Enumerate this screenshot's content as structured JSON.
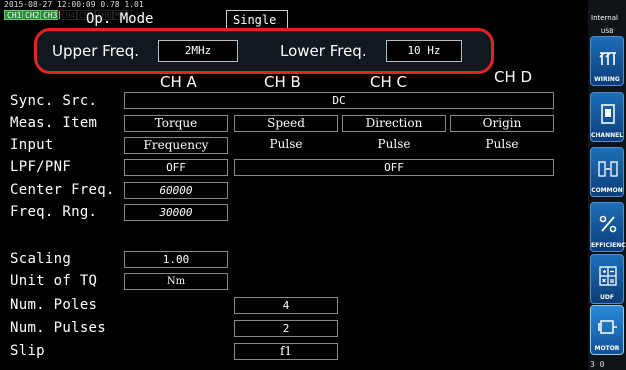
{
  "status": {
    "timestamp": "2015-08-27 12:00:09 0.78 1.01",
    "channels": [
      {
        "label": "CH1",
        "active": true
      },
      {
        "label": "CH2",
        "active": true
      },
      {
        "label": "CH3",
        "active": true
      },
      {
        "label": "CH4",
        "active": false
      },
      {
        "label": "CH5",
        "active": false
      },
      {
        "label": "CH6",
        "active": false
      },
      {
        "label": "MOT",
        "active": false
      }
    ]
  },
  "op_mode": {
    "label": "Op. Mode",
    "value": "Single"
  },
  "freq": {
    "upper_label": "Upper Freq.",
    "upper_value": "2MHz",
    "lower_label": "Lower Freq.",
    "lower_value": "10 Hz"
  },
  "columns": {
    "a": "CH A",
    "b": "CH B",
    "c": "CH C",
    "d": "CH D"
  },
  "rows": {
    "sync_src": {
      "label": "Sync. Src.",
      "value": "DC"
    },
    "meas_item": {
      "label": "Meas. Item",
      "a": "Torque",
      "b": "Speed",
      "c": "Direction",
      "d": "Origin"
    },
    "input": {
      "label": "Input",
      "a": "Frequency",
      "b": "Pulse",
      "c": "Pulse",
      "d": "Pulse"
    },
    "lpf": {
      "label": "LPF/PNF",
      "a": "OFF",
      "bcd": "OFF"
    },
    "center_freq": {
      "label": "Center Freq.",
      "a": "60000"
    },
    "freq_rng": {
      "label": "Freq. Rng.",
      "a": "30000"
    },
    "scaling": {
      "label": "Scaling",
      "a": "1.00"
    },
    "unit_tq": {
      "label": "Unit of TQ",
      "a": "Nm"
    },
    "num_poles": {
      "label": "Num. Poles",
      "b": "4"
    },
    "num_pulses": {
      "label": "Num. Pulses",
      "b": "2"
    },
    "slip": {
      "label": "Slip",
      "b": "f1"
    }
  },
  "side": {
    "storage_label": "Internal",
    "storage_sub": "USB",
    "buttons": {
      "wiring": "WIRING",
      "channel": "CHANNEL",
      "common": "COMMON",
      "efficiency": "EFFICIENCY",
      "udf": "UDF",
      "motor": "MOTOR"
    },
    "footer": "3  0"
  }
}
